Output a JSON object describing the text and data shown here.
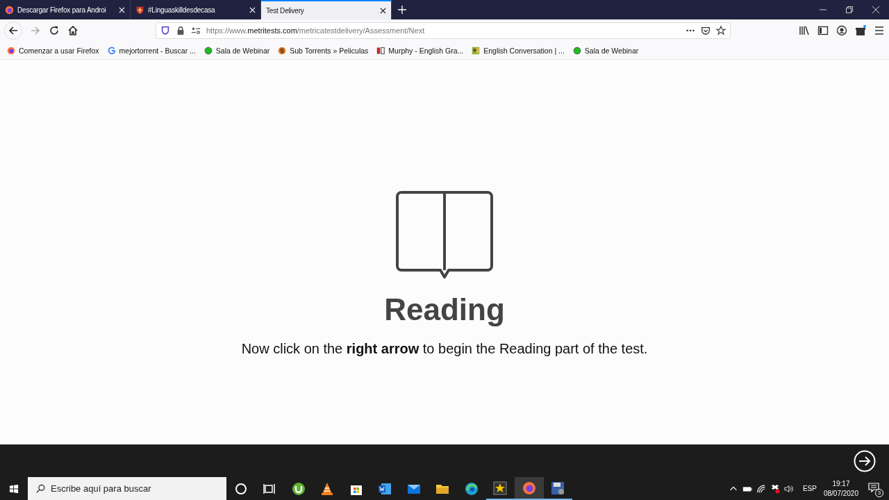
{
  "tabs": [
    {
      "title": "Descargar Firefox para Androi",
      "kind": "firefox",
      "selected": false
    },
    {
      "title": "#Linguaskilldesdecasa",
      "kind": "shield",
      "selected": false
    },
    {
      "title": "Test Delivery",
      "kind": "plain",
      "selected": true
    }
  ],
  "address": {
    "prefix": "https://www.",
    "domain": "metritests.com",
    "path": "/metricatestdelivery/Assessment/Next"
  },
  "bookmarks": [
    {
      "label": "Comenzar a usar Firefox",
      "kind": "firefox"
    },
    {
      "label": "mejortorrent - Buscar ...",
      "kind": "google"
    },
    {
      "label": "Sala de Webinar",
      "kind": "dot"
    },
    {
      "label": "Sub Torrents » Peliculas",
      "kind": "s"
    },
    {
      "label": "Murphy - English Gra...",
      "kind": "pd"
    },
    {
      "label": "English Conversation | ...",
      "kind": "photo"
    },
    {
      "label": "Sala de Webinar",
      "kind": "dot"
    }
  ],
  "page": {
    "heading": "Reading",
    "instruction": "Now click on the **right arrow** to begin the Reading part of the test."
  },
  "taskbar": {
    "search_placeholder": "Escribe aquí para buscar",
    "apps": [
      {
        "kind": "cortana",
        "running": false
      },
      {
        "kind": "taskview",
        "running": false
      },
      {
        "kind": "utorrent",
        "running": false
      },
      {
        "kind": "vlc",
        "running": false
      },
      {
        "kind": "store",
        "running": false
      },
      {
        "kind": "word",
        "running": false
      },
      {
        "kind": "mail",
        "running": false
      },
      {
        "kind": "folder",
        "running": false
      },
      {
        "kind": "edge",
        "running": false
      },
      {
        "kind": "star",
        "running": true
      },
      {
        "kind": "firefox",
        "running": true,
        "selected": true
      },
      {
        "kind": "floppy",
        "running": true
      }
    ],
    "language": "ESP",
    "time": "19:17",
    "date": "08/07/2020",
    "notifications": "3"
  }
}
